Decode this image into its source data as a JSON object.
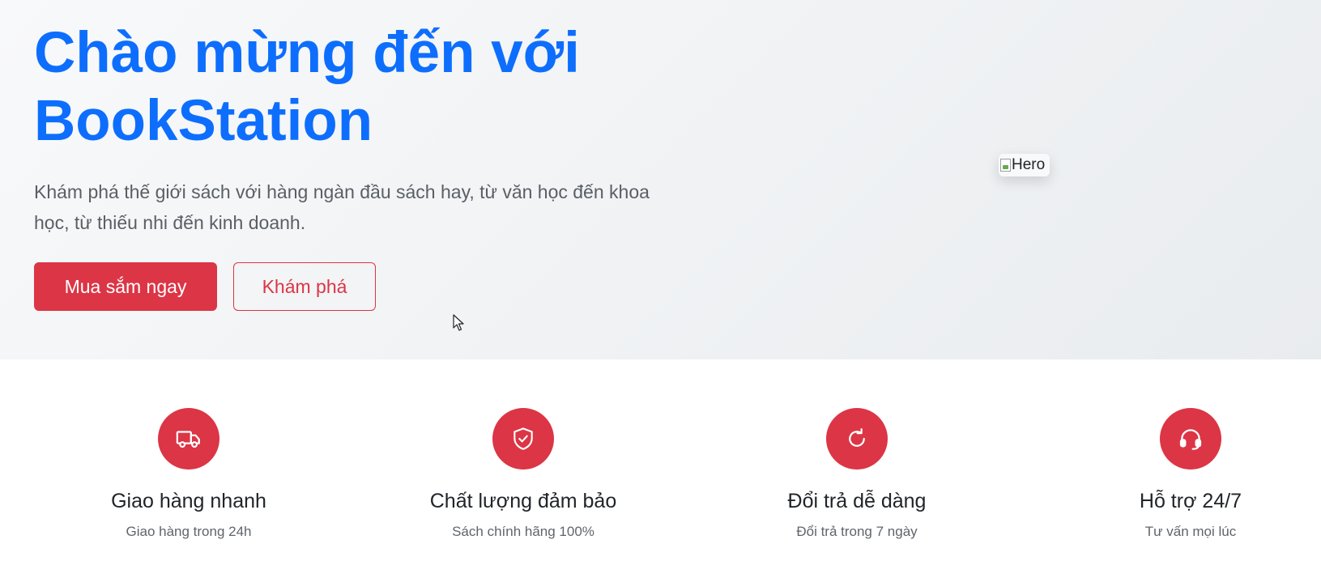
{
  "hero": {
    "title_line1": "Chào mừng đến với",
    "title_line2": "BookStation",
    "description": "Khám phá thế giới sách với hàng ngàn đầu sách hay, từ văn học đến khoa học, từ thiếu nhi đến kinh doanh.",
    "primary_button": "Mua sắm ngay",
    "secondary_button": "Khám phá",
    "image_alt": "Hero"
  },
  "features": [
    {
      "icon": "truck-icon",
      "title": "Giao hàng nhanh",
      "description": "Giao hàng trong 24h"
    },
    {
      "icon": "shield-check-icon",
      "title": "Chất lượng đảm bảo",
      "description": "Sách chính hãng 100%"
    },
    {
      "icon": "refresh-icon",
      "title": "Đổi trả dễ dàng",
      "description": "Đổi trả trong 7 ngày"
    },
    {
      "icon": "headset-icon",
      "title": "Hỗ trợ 24/7",
      "description": "Tư vấn mọi lúc"
    }
  ],
  "colors": {
    "primary": "#dc3545",
    "title_blue": "#0d6efd",
    "hero_bg_start": "#f8f9fa",
    "hero_bg_end": "#e9ecef"
  }
}
